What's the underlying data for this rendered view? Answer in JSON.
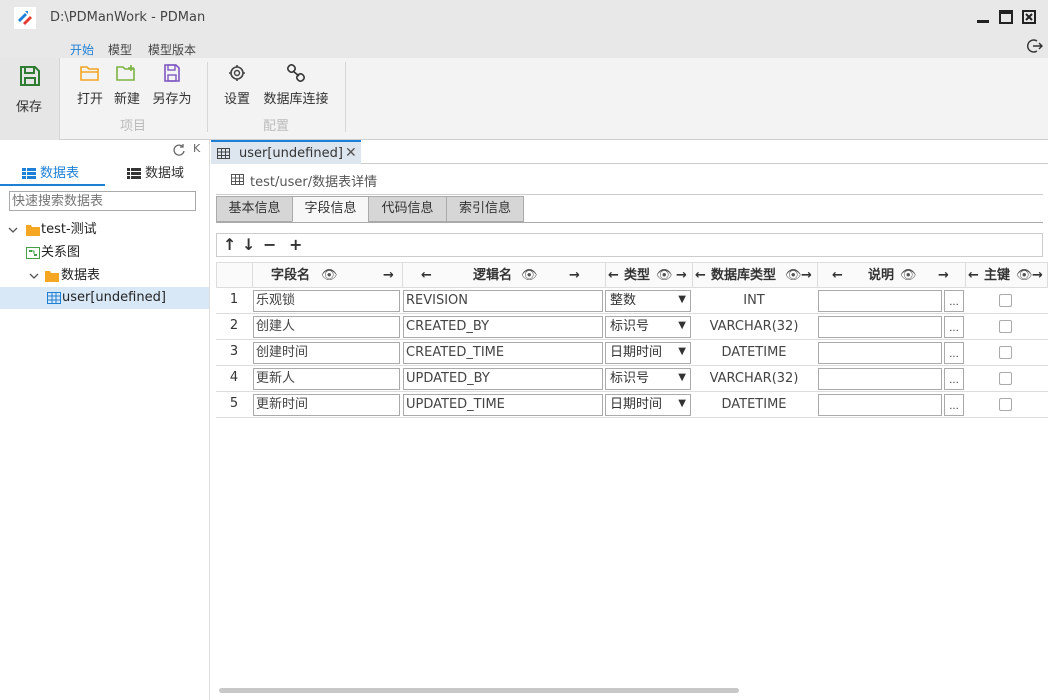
{
  "window": {
    "title": "D:\\PDManWork - PDMan"
  },
  "menu": {
    "tabs": [
      {
        "label": "开始",
        "active": true
      },
      {
        "label": "模型",
        "active": false
      },
      {
        "label": "模型版本",
        "active": false
      }
    ]
  },
  "ribbon": {
    "save_label": "保存",
    "open_label": "打开",
    "new_label": "新建",
    "saveas_label": "另存为",
    "group_project": "项目",
    "settings_label": "设置",
    "dbconn_label": "数据库连接",
    "group_config": "配置"
  },
  "left_panel": {
    "tab_tables": "数据表",
    "tab_domains": "数据域",
    "search_placeholder": "快速搜索数据表",
    "tree": {
      "project": "test-测试",
      "relation": "关系图",
      "tables_folder": "数据表",
      "table_item": "user[undefined]"
    }
  },
  "doc_tab": {
    "label": "user[undefined]",
    "close": "✕"
  },
  "breadcrumb": "test/user/数据表详情",
  "subtabs": [
    "基本信息",
    "字段信息",
    "代码信息",
    "索引信息"
  ],
  "grid": {
    "headers": {
      "field_name": "字段名",
      "logic_name": "逻辑名",
      "type": "类型",
      "db_type": "数据库类型",
      "comment": "说明",
      "pk": "主键"
    },
    "rows": [
      {
        "num": "1",
        "field": "乐观锁",
        "logic": "REVISION",
        "type": "整数",
        "db_type": "INT",
        "comment": ""
      },
      {
        "num": "2",
        "field": "创建人",
        "logic": "CREATED_BY",
        "type": "标识号",
        "db_type": "VARCHAR(32)",
        "comment": ""
      },
      {
        "num": "3",
        "field": "创建时间",
        "logic": "CREATED_TIME",
        "type": "日期时间",
        "db_type": "DATETIME",
        "comment": ""
      },
      {
        "num": "4",
        "field": "更新人",
        "logic": "UPDATED_BY",
        "type": "标识号",
        "db_type": "VARCHAR(32)",
        "comment": ""
      },
      {
        "num": "5",
        "field": "更新时间",
        "logic": "UPDATED_TIME",
        "type": "日期时间",
        "db_type": "DATETIME",
        "comment": ""
      }
    ]
  },
  "colors": {
    "accent": "#1e7fd6",
    "folder": "#f5a623"
  }
}
